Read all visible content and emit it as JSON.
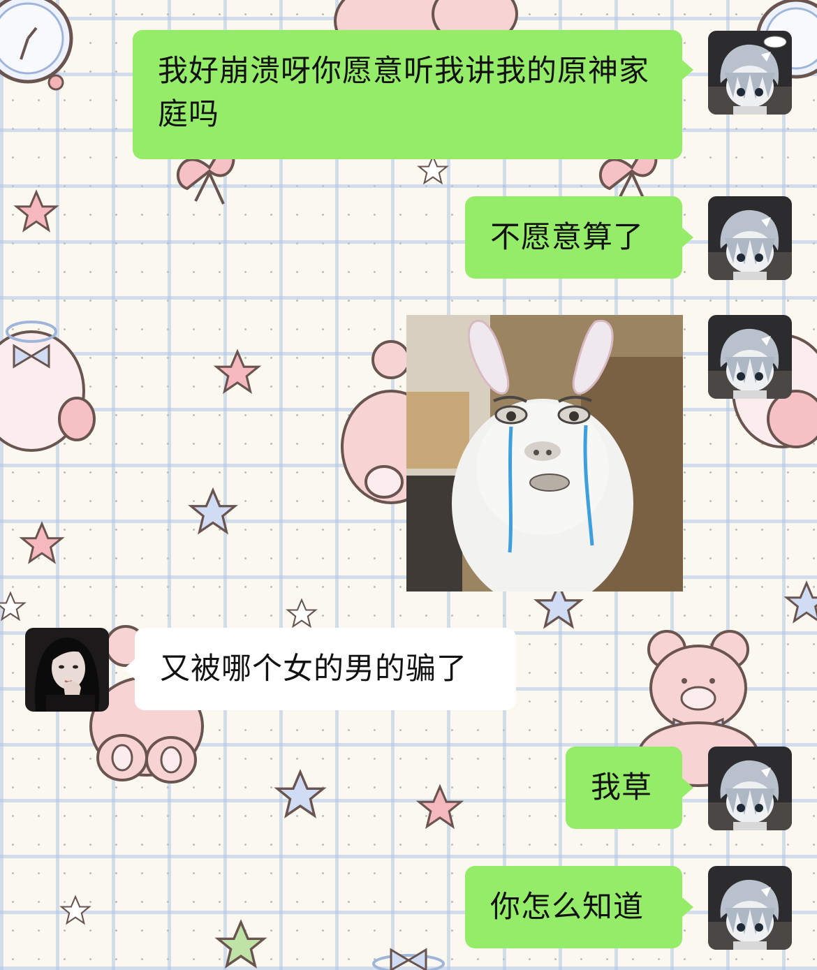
{
  "chat": {
    "messages": [
      {
        "sender": "me",
        "type": "text",
        "text": "我好崩溃呀你愿意听我讲我的原神家庭吗"
      },
      {
        "sender": "me",
        "type": "text",
        "text": "不愿意算了"
      },
      {
        "sender": "me",
        "type": "sticker",
        "sticker": "crying-rabbit-meme"
      },
      {
        "sender": "them",
        "type": "text",
        "text": "又被哪个女的男的骗了"
      },
      {
        "sender": "me",
        "type": "text",
        "text": "我草"
      },
      {
        "sender": "me",
        "type": "text",
        "text": "你怎么知道"
      }
    ]
  },
  "theme": {
    "my_bubble_color": "#95ec69",
    "their_bubble_color": "#ffffff",
    "background_grid_color": "#b0c6e8",
    "background_base_color": "#fbf8ef"
  },
  "icons": {
    "my_avatar": "anime-boy-avatar",
    "their_avatar": "girl-photo-avatar",
    "background": [
      "star-icon",
      "bear-icon",
      "bow-icon",
      "clock-icon"
    ]
  }
}
